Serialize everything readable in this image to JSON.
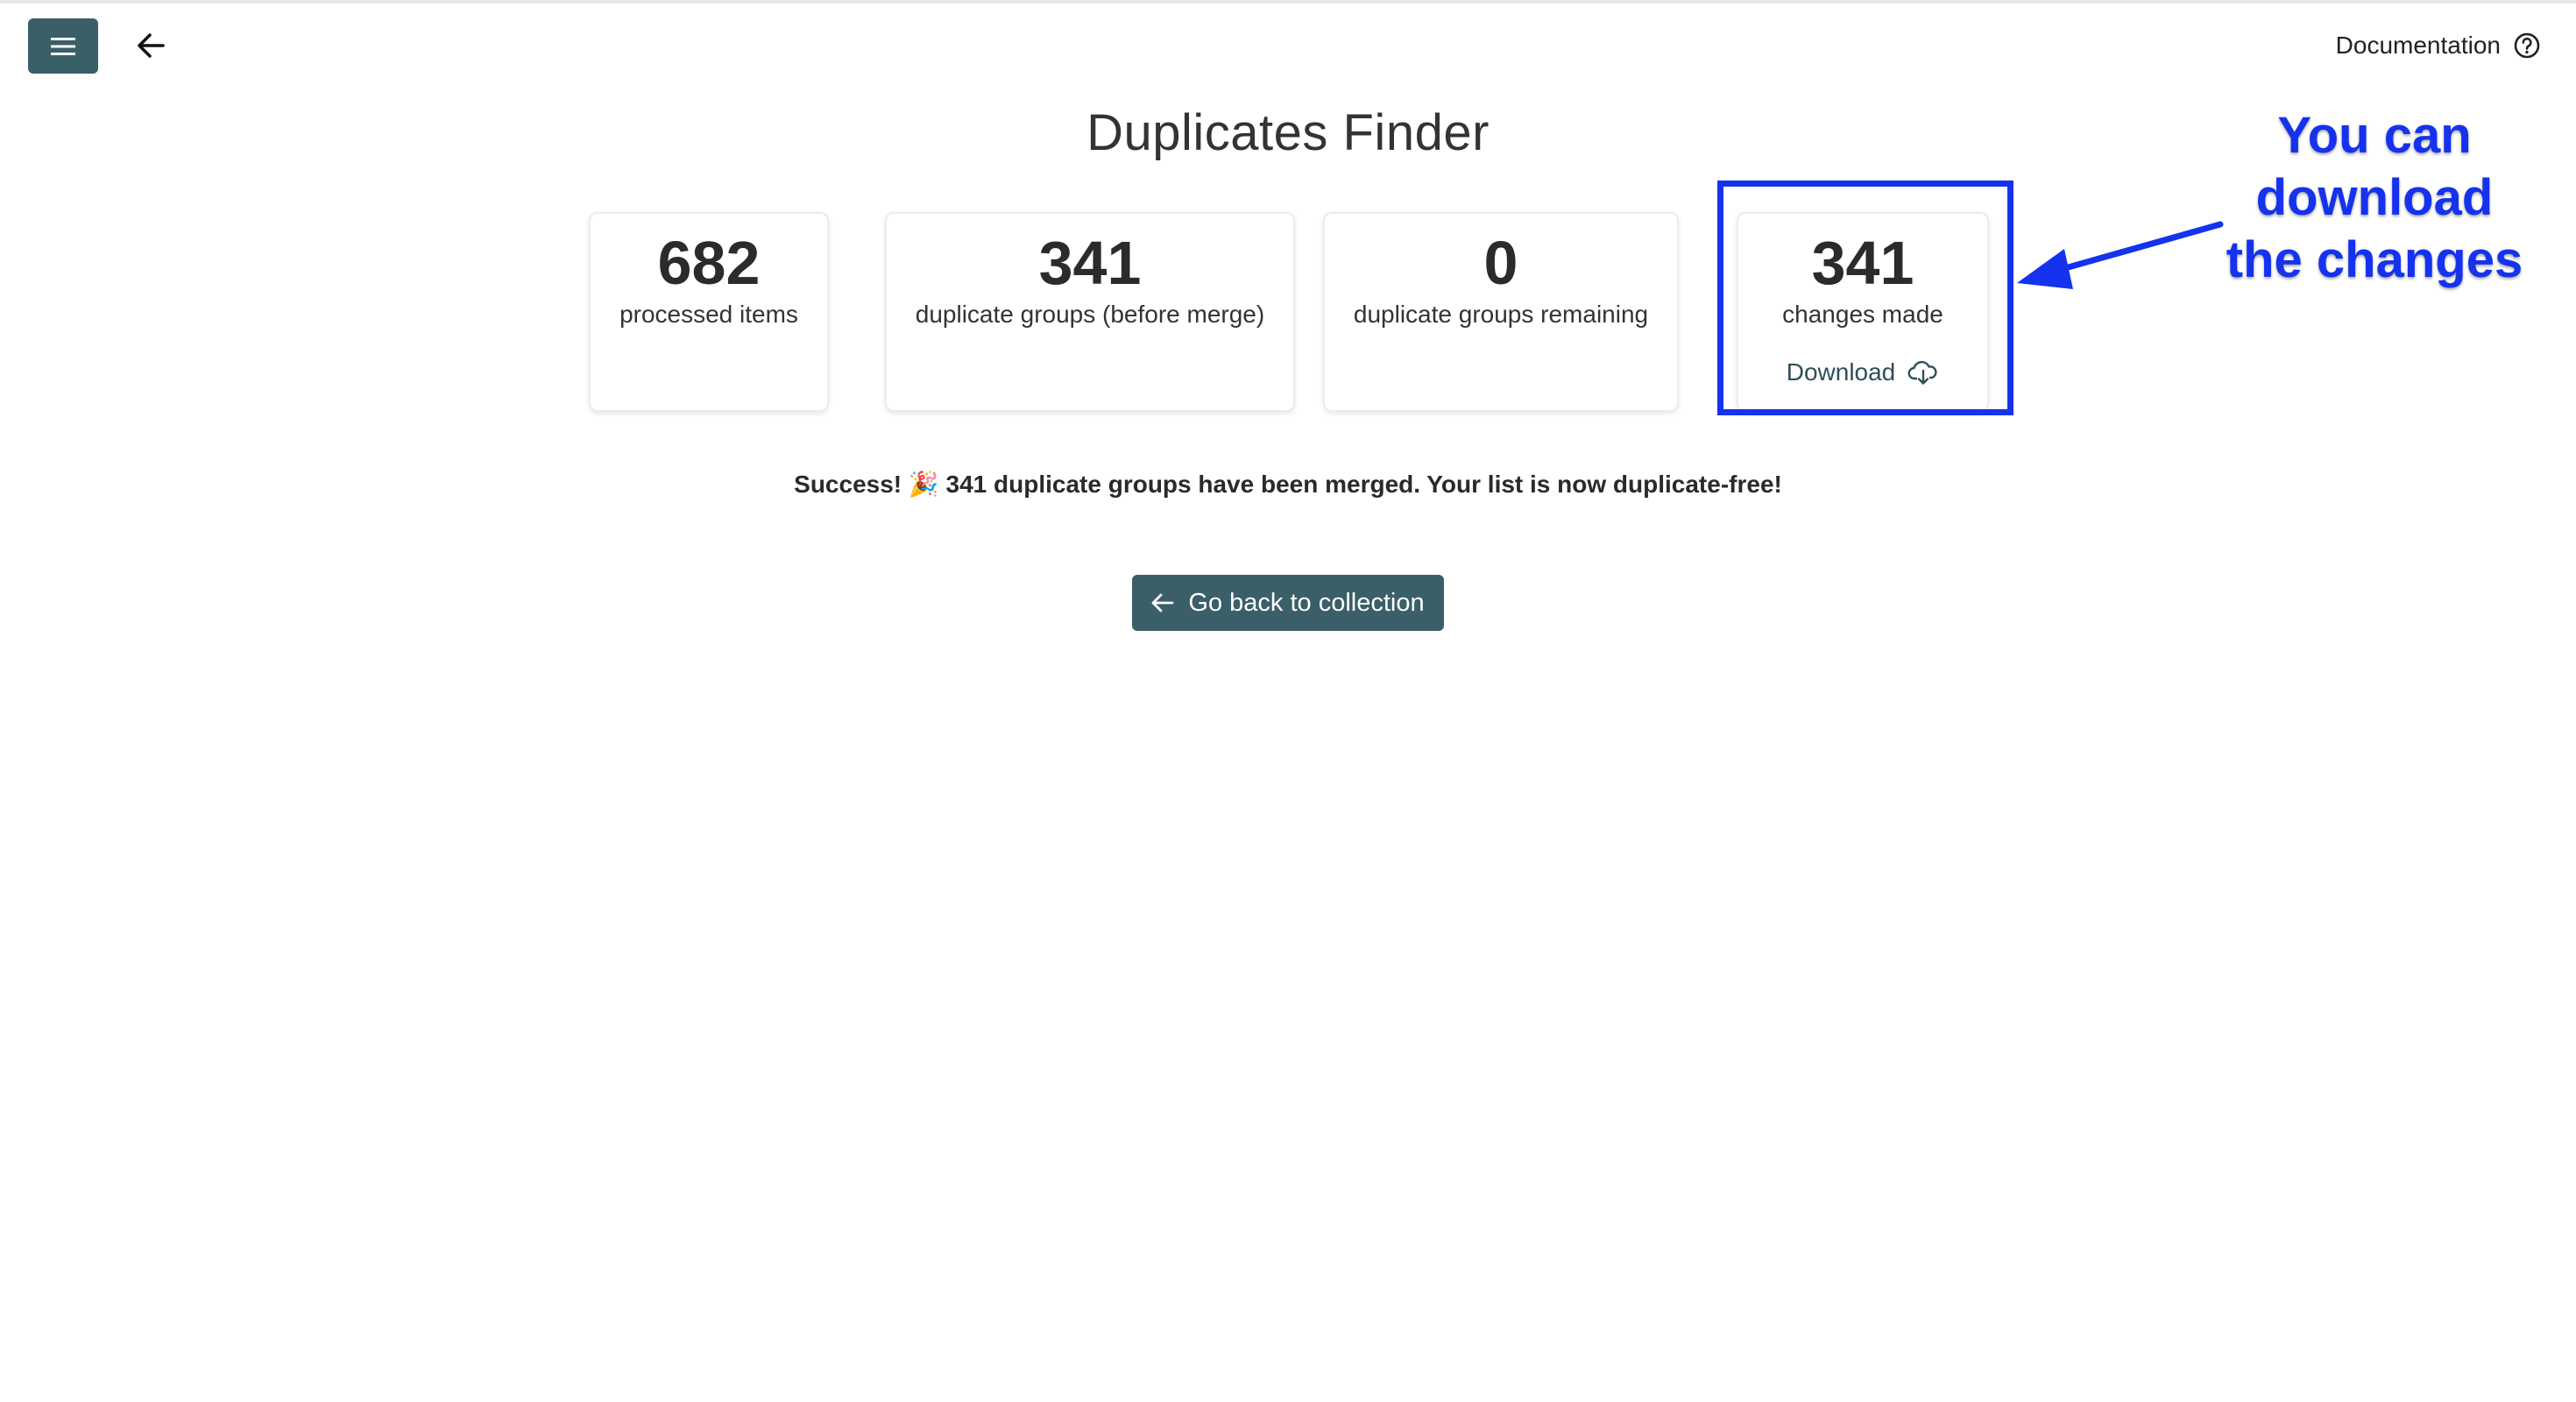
{
  "header": {
    "menu_icon": "menu-icon",
    "back_icon": "arrow-left-icon",
    "documentation_label": "Documentation",
    "documentation_icon": "help-circle-icon"
  },
  "page": {
    "title": "Duplicates Finder"
  },
  "stats": [
    {
      "value": "682",
      "label": "processed items"
    },
    {
      "value": "341",
      "label": "duplicate groups (before merge)"
    },
    {
      "value": "0",
      "label": "duplicate groups remaining"
    },
    {
      "value": "341",
      "label": "changes made",
      "action_label": "Download",
      "action_icon": "cloud-download-icon"
    }
  ],
  "success_message": "Success! 🎉 341 duplicate groups have been merged. Your list is now duplicate-free!",
  "go_back_button": {
    "label": "Go back to collection",
    "icon": "arrow-left-icon"
  },
  "annotation": {
    "text_line1": "You can",
    "text_line2": "download",
    "text_line3": "the changes",
    "color": "#1532ee"
  },
  "colors": {
    "primary": "#3a5f68",
    "annotation": "#1532ee"
  }
}
